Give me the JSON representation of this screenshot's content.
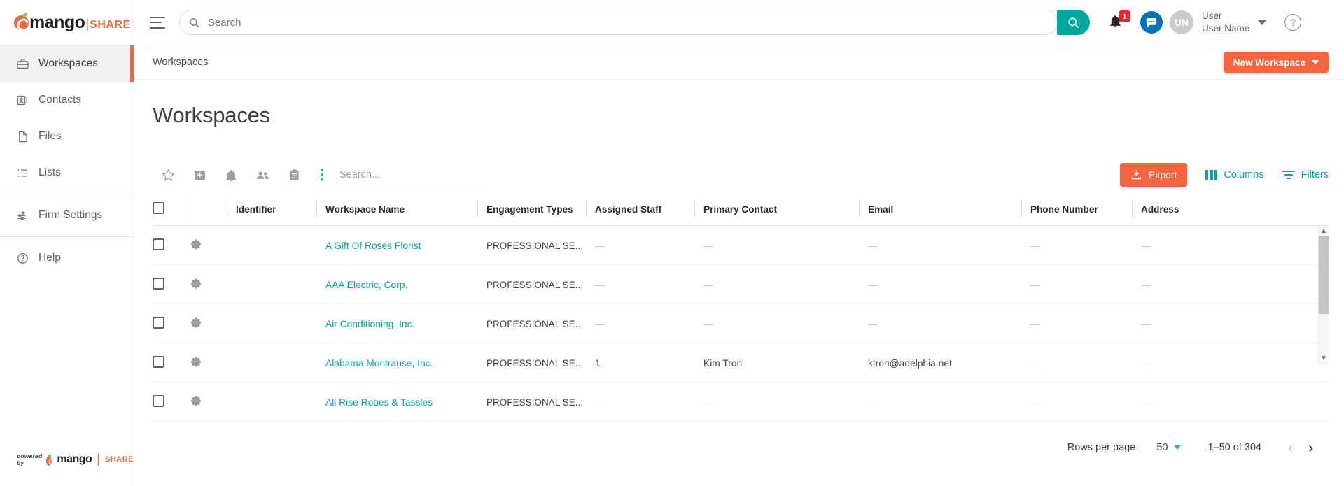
{
  "brand": {
    "name": "mango",
    "suffix": "SHARE",
    "divider": "|"
  },
  "sidebar": {
    "items": [
      {
        "label": "Workspaces",
        "icon": "briefcase-icon",
        "active": true
      },
      {
        "label": "Contacts",
        "icon": "contact-card-icon",
        "active": false
      },
      {
        "label": "Files",
        "icon": "file-icon",
        "active": false
      },
      {
        "label": "Lists",
        "icon": "list-icon",
        "active": false
      },
      {
        "label": "Firm Settings",
        "icon": "sliders-icon",
        "active": false
      },
      {
        "label": "Help",
        "icon": "question-circle-icon",
        "active": false
      }
    ],
    "footer": {
      "powered_by": "powered by",
      "name": "mango",
      "suffix": "SHARE"
    }
  },
  "topbar": {
    "menu_icon": "hamburger-icon",
    "search": {
      "placeholder": "Search",
      "value": "",
      "icon": "search-icon",
      "button_icon": "search-icon"
    },
    "notifications": {
      "icon": "bell-icon",
      "count": "1"
    },
    "chat": {
      "icon": "chat-bubble-icon"
    },
    "user": {
      "initials": "UN",
      "line1": "User",
      "line2": "User Name"
    },
    "help": {
      "icon": "question-mark-icon",
      "label": "?"
    }
  },
  "breadcrumb": {
    "label": "Workspaces"
  },
  "new_workspace": {
    "label": "New Workspace",
    "icon": "chevron-down-icon",
    "color": "#f4653f"
  },
  "page": {
    "title": "Workspaces"
  },
  "toolbar": {
    "icons": [
      {
        "name": "star-icon"
      },
      {
        "name": "archive-icon"
      },
      {
        "name": "bell-icon"
      },
      {
        "name": "people-icon"
      },
      {
        "name": "clipboard-icon"
      },
      {
        "name": "more-vertical-icon"
      }
    ],
    "search": {
      "placeholder": "Search...",
      "value": ""
    },
    "export": {
      "label": "Export",
      "icon": "download-icon",
      "color": "#f4653f"
    },
    "columns": {
      "label": "Columns",
      "icon": "columns-icon",
      "color": "#00a79d"
    },
    "filters": {
      "label": "Filters",
      "icon": "filter-icon",
      "color": "#00a79d"
    }
  },
  "table": {
    "columns": [
      "",
      "",
      "Identifier",
      "Workspace Name",
      "Engagement Types",
      "Assigned Staff",
      "Primary Contact",
      "Email",
      "Phone Number",
      "Address"
    ],
    "rows": [
      {
        "identifier": "",
        "name": "A Gift Of Roses Florist",
        "engagement": "PROFESSIONAL SE...",
        "staff": "—",
        "contact": "—",
        "email": "—",
        "phone": "—",
        "address": "—"
      },
      {
        "identifier": "",
        "name": "AAA Electric, Corp.",
        "engagement": "PROFESSIONAL SE...",
        "staff": "—",
        "contact": "—",
        "email": "—",
        "phone": "—",
        "address": "—"
      },
      {
        "identifier": "",
        "name": "Air Conditioning, Inc.",
        "engagement": "PROFESSIONAL SE...",
        "staff": "—",
        "contact": "—",
        "email": "—",
        "phone": "—",
        "address": "—"
      },
      {
        "identifier": "",
        "name": "Alabama Montrause, Inc.",
        "engagement": "PROFESSIONAL SE...",
        "staff": "1",
        "contact": "Kim Tron",
        "email": "ktron@adelphia.net",
        "phone": "—",
        "address": "—"
      },
      {
        "identifier": "",
        "name": "All Rise Robes & Tassles",
        "engagement": "PROFESSIONAL SE...",
        "staff": "—",
        "contact": "—",
        "email": "—",
        "phone": "—",
        "address": "—"
      }
    ]
  },
  "pagination": {
    "rows_per_page_label": "Rows per page:",
    "rows_per_page_value": "50",
    "range": "1–50 of 304",
    "prev_icon": "chevron-left-icon",
    "next_icon": "chevron-right-icon",
    "prev_glyph": "‹",
    "next_glyph": "›"
  }
}
